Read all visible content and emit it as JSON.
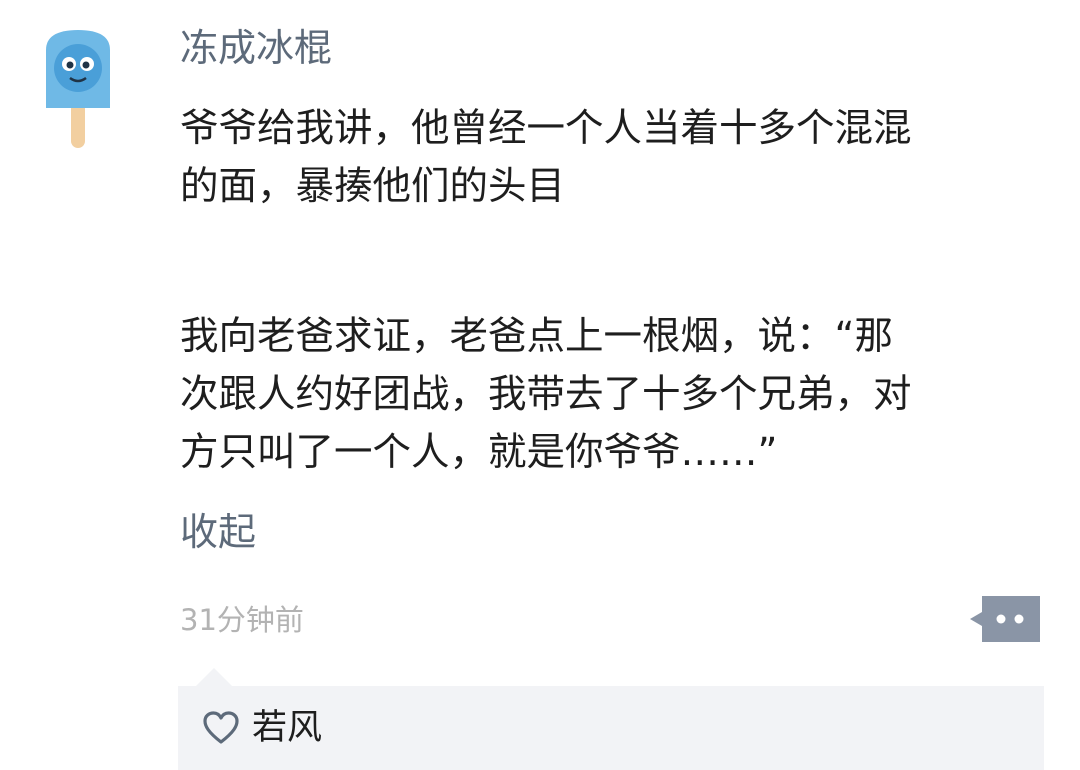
{
  "post": {
    "username": "冻成冰棍",
    "paragraph1": [
      "爷爷给我讲，他曾经一个人当着十多个混混",
      "的面，暴揍他们的头目"
    ],
    "paragraph2": [
      "我向老爸求证，老爸点上一根烟，说：“那",
      "次跟人约好团战，我带去了十多个兄弟，对",
      "方只叫了一个人，就是你爷爷……”"
    ],
    "collapse_label": "收起",
    "timestamp": "31分钟前"
  },
  "likes": {
    "users": [
      "若风"
    ]
  },
  "colors": {
    "name_link": "#5d6a7a",
    "body_text": "#1e1e1e",
    "timestamp": "#b3b3b3",
    "avatar_blue": "#6fb9e6",
    "comment_icon": "#8a95a6",
    "likes_background": "#f2f3f6"
  },
  "icons": {
    "avatar": "popsicle-avatar-icon",
    "comment": "comment-bubble-icon",
    "like": "heart-outline-icon"
  }
}
